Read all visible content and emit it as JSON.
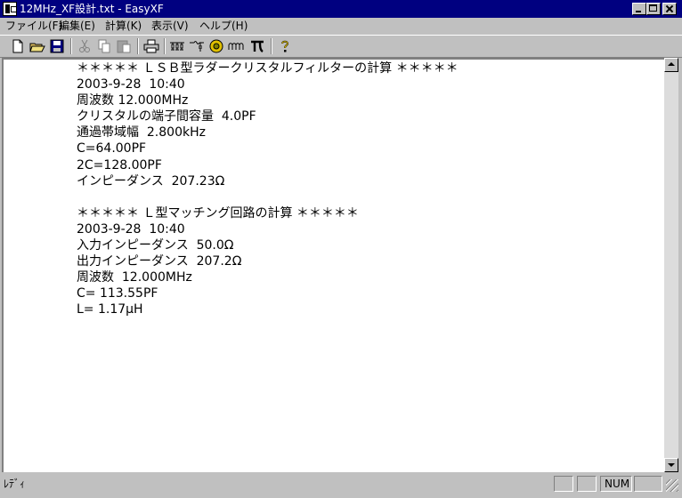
{
  "window": {
    "title": "12MHz_XF設計.txt - EasyXF",
    "icon": "easyxf-app-icon"
  },
  "menu": [
    {
      "label": "ファイル(F)"
    },
    {
      "label": "編集(E)"
    },
    {
      "label": "計算(K)"
    },
    {
      "label": "表示(V)"
    },
    {
      "label": "ヘルプ(H)"
    }
  ],
  "toolbar": [
    {
      "icon": "new-file-icon"
    },
    {
      "icon": "open-folder-icon"
    },
    {
      "icon": "save-icon"
    },
    {
      "icon": "cut-icon"
    },
    {
      "icon": "copy-icon"
    },
    {
      "icon": "paste-icon"
    },
    {
      "icon": "print-icon"
    },
    {
      "icon": "ladder-filter-icon"
    },
    {
      "icon": "matching-network-icon"
    },
    {
      "icon": "crystal-icon"
    },
    {
      "icon": "coil-icon"
    },
    {
      "icon": "pi-network-icon"
    },
    {
      "icon": "help-icon"
    }
  ],
  "document": {
    "text": "＊＊＊＊＊ ＬＳＢ型ラダークリスタルフィルターの計算 ＊＊＊＊＊\n2003-9-28  10:40\n周波数 12.000MHz\nクリスタルの端子間容量  4.0PF\n通過帯域幅  2.800kHz\nC=64.00PF\n2C=128.00PF\nインピーダンス  207.23Ω\n\n＊＊＊＊＊ Ｌ型マッチング回路の計算 ＊＊＊＊＊\n2003-9-28  10:40\n入力インピーダンス  50.0Ω\n出力インピーダンス  207.2Ω\n周波数  12.000MHz\nC= 113.55PF\nL= 1.17μH"
  },
  "status": {
    "text": "ﾚﾃﾞｨ",
    "num": "NUM"
  }
}
